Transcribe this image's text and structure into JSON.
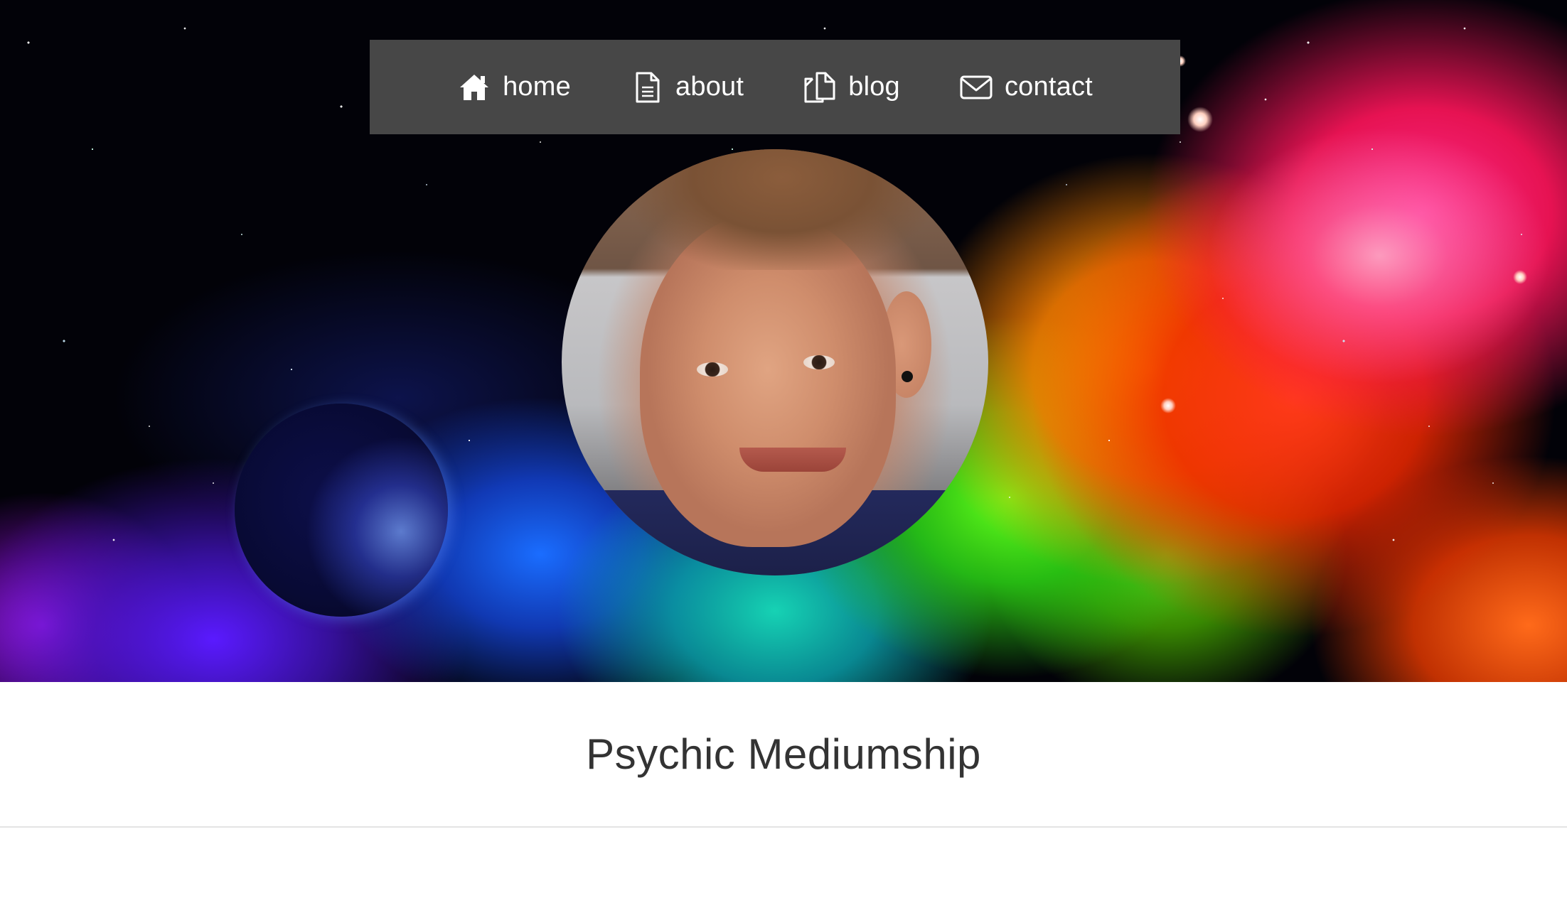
{
  "nav": {
    "items": [
      {
        "label": "home",
        "icon": "home-icon"
      },
      {
        "label": "about",
        "icon": "document-icon"
      },
      {
        "label": "blog",
        "icon": "copy-icon"
      },
      {
        "label": "contact",
        "icon": "envelope-icon"
      }
    ]
  },
  "hero": {
    "background": "space-nebula",
    "avatar": "profile-photo"
  },
  "page": {
    "title": "Psychic Mediumship"
  },
  "colors": {
    "nav_background": "#474747",
    "nav_text": "#ffffff",
    "title_text": "#333333",
    "divider": "#e4e4e4"
  }
}
